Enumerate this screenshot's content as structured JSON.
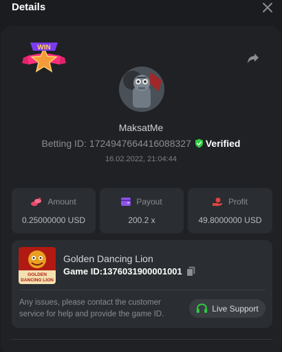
{
  "header": {
    "title": "Details"
  },
  "user": {
    "username": "MaksatMe",
    "betting_label": "Betting ID:",
    "betting_id": "1724947664416088327",
    "verified_label": "Verified",
    "timestamp": "16.02.2022, 21:04:44"
  },
  "badge": {
    "text": "WIN"
  },
  "stats": [
    {
      "label": "Amount",
      "value": "0.25000000 USD",
      "icon": "coins-icon",
      "color": "#e8456b"
    },
    {
      "label": "Payout",
      "value": "200.2 x",
      "icon": "wallet-icon",
      "color": "#8e54e9"
    },
    {
      "label": "Profit",
      "value": "49.8000000 USD",
      "icon": "hand-money-icon",
      "color": "#e0443c"
    }
  ],
  "game": {
    "name": "Golden Dancing Lion",
    "id_label": "Game ID:",
    "id_value": "1376031900001001",
    "thumb_title_1": "GOLDEN",
    "thumb_title_2": "DANCING LION"
  },
  "support": {
    "text": "Any issues, please contact the customer service for help and provide the game ID.",
    "button_label": "Live Support"
  },
  "colors": {
    "verified": "#2ecc40",
    "support_icon": "#2ecc40"
  }
}
